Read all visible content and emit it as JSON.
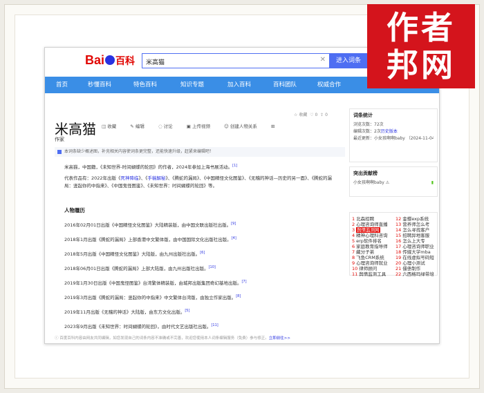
{
  "header": {
    "logo_text": "Bai",
    "logo_suffix": "百科",
    "search_value": "米高猫",
    "enter_button": "进入词条"
  },
  "nav": [
    "首页",
    "秒懂百科",
    "特色百科",
    "知识专题",
    "加入百科",
    "百科团队",
    "权威合作"
  ],
  "article": {
    "title": "米高猫",
    "subtitle": "作家",
    "tools": [
      "收藏",
      "编辑",
      "讨论",
      "上传视频",
      "创建人物关系"
    ],
    "top_counts": {
      "star": "收藏",
      "like": "0",
      "share": "0"
    },
    "notice": "本词条缺少概述图，补充相关内容使词条更完整，还能快速升级，赶紧来编辑吧！",
    "intro": "米高猫，中国籍，《未知世界-时间蝴蝶的轮回》的作者，2024年参加上海书展活动。",
    "works_p1": "代表作品有：2022年出版《",
    "works_link1": "死神降临",
    "works_p2": "》、《",
    "works_link2": "手稿解秘",
    "works_p3": "》、《腾蛇的漏局》、《中国精怪文化图鉴》、《无稽的神话—历史的另一面》、《腾蛇的漏局：竖起你的中指来》、《中国鬼怪图鉴》、《未知世界：时间蝴蝶的轮回》等。",
    "section_title": "人物履历",
    "events": [
      {
        "text": "2016年02月01日出版《中国精怪文化图鉴》大陆精装版，由中国文联出版社出版。",
        "ref": "[9]"
      },
      {
        "text": "2018年1月出版《腾蛇的漏局》上部香港中文繁体版，由中国国际文化出版社出版。",
        "ref": "[4]"
      },
      {
        "text": "2018年5月出版《中国精怪文化图鉴》大陆版，由九州出版社出版。",
        "ref": "[6]"
      },
      {
        "text": "2018年06月01日出版《腾蛇的漏局》上部大陆版，由九州出版社出版。",
        "ref": "[10]"
      },
      {
        "text": "2019年1月30日出版《中国鬼怪图鉴》台湾繁体精装版，由城邦出版集团奇幻基地出版。",
        "ref": "[7]"
      },
      {
        "text": "2019年3月出版《腾蛇的漏局：竖起你的中指来》中文繁体台湾版，由独立作家出版。",
        "ref": "[8]"
      },
      {
        "text": "2019年11月出版《无稽的神话》大陆版，由东方文化出版。",
        "ref": "[5]"
      },
      {
        "text": "2023年9月出版《未知世界：时间蝴蝶的轮回》，由时代文艺出版社出版。",
        "ref": "[11]"
      }
    ],
    "footnote": "百度百科内容由网友共同编辑，如您发现自己的词条内容不准确或不完善，欢迎您使用本人词条编辑服务（免费）参与修正。",
    "footnote_link": "立即前往>>"
  },
  "sidebar": {
    "stats_title": "词条统计",
    "views": "浏览次数：72次",
    "edits_label": "编辑次数：2次",
    "edits_link": "历史版本",
    "last_update": "最近更新：小女孩啊啊baby （2024-11-04）",
    "contributor_title": "突出贡献榜",
    "contributor": "小女孩啊啊baby"
  },
  "rank": [
    {
      "n": "1",
      "t": "北森招聘"
    },
    {
      "n": "12",
      "t": "金蝶exp系统"
    },
    {
      "n": "2",
      "t": "心理咨询师直播"
    },
    {
      "n": "13",
      "t": "营养师怎么考"
    },
    {
      "n": "3",
      "t": "舆情监测网"
    },
    {
      "n": "14",
      "t": "怎么寻找客户"
    },
    {
      "n": "4",
      "t": "精神心理科咨询"
    },
    {
      "n": "15",
      "t": "招聘异地客服"
    },
    {
      "n": "5",
      "t": "erp软件排名"
    },
    {
      "n": "16",
      "t": "怎么上大专"
    },
    {
      "n": "6",
      "t": "家庭教育指导师"
    },
    {
      "n": "17",
      "t": "心理咨询师职业"
    },
    {
      "n": "7",
      "t": "藏分子弟"
    },
    {
      "n": "18",
      "t": "传媒大学mba"
    },
    {
      "n": "8",
      "t": "飞鱼CRM系统"
    },
    {
      "n": "19",
      "t": "在线虚拟号码短"
    },
    {
      "n": "9",
      "t": "心理咨询师就业"
    },
    {
      "n": "20",
      "t": "心理小测试"
    },
    {
      "n": "10",
      "t": "律师顾问"
    },
    {
      "n": "21",
      "t": "僵债制作"
    },
    {
      "n": "11",
      "t": "舆情监测工具"
    },
    {
      "n": "22",
      "t": "六西格玛绿带培"
    }
  ],
  "badge": {
    "line1": "作者",
    "line2": "邦网"
  },
  "colors": {
    "nav": "#3a8ee6",
    "badge": "#d4141c",
    "link": "#2932e1",
    "accent": "#e10602"
  }
}
